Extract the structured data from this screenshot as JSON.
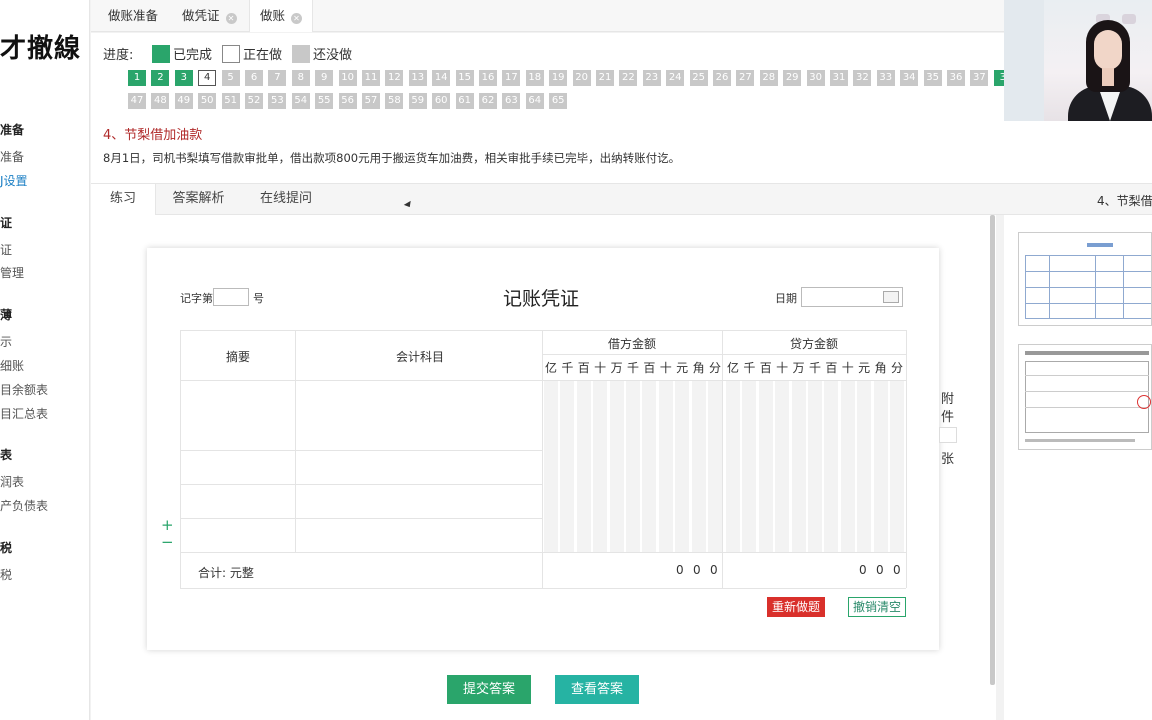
{
  "sidebar": {
    "logo_text": "才撤線",
    "groups": [
      {
        "title": "准备",
        "items": [
          {
            "label": "准备",
            "active": false
          },
          {
            "label": "J设置",
            "active": true
          }
        ]
      },
      {
        "title": "证",
        "items": [
          {
            "label": "证",
            "active": false
          },
          {
            "label": "管理",
            "active": false
          }
        ]
      },
      {
        "title": "薄",
        "items": [
          {
            "label": "示",
            "active": false
          },
          {
            "label": "细账",
            "active": false
          },
          {
            "label": "目余额表",
            "active": false
          },
          {
            "label": "目汇总表",
            "active": false
          }
        ]
      },
      {
        "title": "表",
        "items": [
          {
            "label": "润表",
            "active": false
          },
          {
            "label": "产负债表",
            "active": false
          }
        ]
      },
      {
        "title": "税",
        "items": [
          {
            "label": "税",
            "active": false
          }
        ]
      }
    ]
  },
  "tabs": [
    {
      "label": "做账准备",
      "closable": false,
      "active": false
    },
    {
      "label": "做凭证",
      "closable": true,
      "active": false
    },
    {
      "label": "做账",
      "closable": true,
      "active": true
    }
  ],
  "progress": {
    "label": "进度:",
    "legend": [
      {
        "label": "已完成",
        "color": "#2aa56b"
      },
      {
        "label": "正在做",
        "color": "#ffffff"
      },
      {
        "label": "还没做",
        "color": "#c8c8c8"
      }
    ],
    "row1": [
      "1",
      "2",
      "3",
      "4",
      "5",
      "6",
      "7",
      "8",
      "9",
      "10",
      "11",
      "12",
      "13",
      "14",
      "15",
      "16",
      "17",
      "18",
      "19",
      "20",
      "21",
      "22",
      "23",
      "24",
      "25",
      "26",
      "27",
      "28",
      "29",
      "30",
      "31",
      "32",
      "33",
      "34",
      "35",
      "36",
      "37",
      "3"
    ],
    "row2": [
      "47",
      "48",
      "49",
      "50",
      "51",
      "52",
      "53",
      "54",
      "55",
      "56",
      "57",
      "58",
      "59",
      "60",
      "61",
      "62",
      "63",
      "64",
      "65"
    ],
    "done": [
      "1",
      "2",
      "3"
    ],
    "current": "4"
  },
  "question": {
    "title": "4、节梨借加油款",
    "description": "8月1日，司机书梨填写借款审批单，借出款项800元用于搬运货车加油费，相关审批手续已完毕，出纳转账付讫。"
  },
  "lower_tabs": [
    {
      "label": "练习",
      "active": true
    },
    {
      "label": "答案解析",
      "active": false
    },
    {
      "label": "在线提问",
      "active": false
    }
  ],
  "right_panel_title": "4、节梨借",
  "voucher": {
    "title": "记账凭证",
    "number_prefix": "记字第",
    "number_suffix": "号",
    "date_label": "日期",
    "columns": {
      "summary": "摘要",
      "account": "会计科目",
      "debit": "借方金额",
      "credit": "贷方金额"
    },
    "digits": [
      "亿",
      "千",
      "百",
      "十",
      "万",
      "千",
      "百",
      "十",
      "元",
      "角",
      "分"
    ],
    "total_label": "合计: 元整",
    "debit_total": [
      "0",
      "0",
      "0"
    ],
    "credit_total": [
      "0",
      "0",
      "0"
    ],
    "attachment": {
      "line1": "附",
      "line2": "件",
      "line3": "张"
    },
    "add_row": "+",
    "remove_row": "−",
    "redo_button": "重新做题",
    "clear_button": "撤销清空"
  },
  "actions": {
    "submit": "提交答案",
    "view": "查看答案"
  },
  "colors": {
    "done": "#2aa56b",
    "redo": "#d9302b",
    "submit": "#2aa56b",
    "view": "#26b3a3",
    "question_title": "#b02a2a"
  }
}
